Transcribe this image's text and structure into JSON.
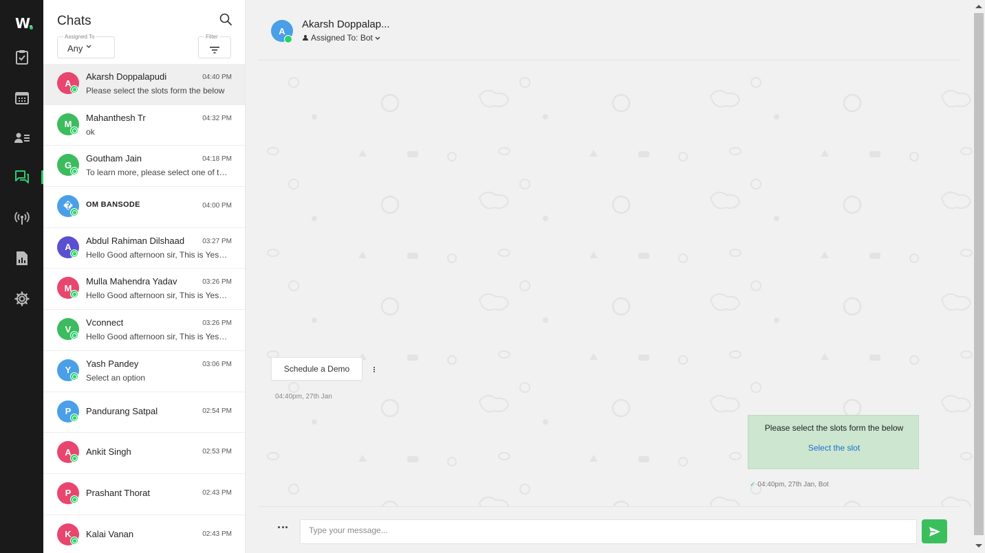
{
  "brand": {
    "logo": "W.",
    "accent": "#2ecc71"
  },
  "rail": {
    "items": [
      {
        "icon": "clipboard-check-icon"
      },
      {
        "icon": "calendar-icon"
      },
      {
        "icon": "contacts-icon"
      },
      {
        "icon": "chats-icon",
        "active": true
      },
      {
        "icon": "broadcast-icon"
      },
      {
        "icon": "report-icon"
      },
      {
        "icon": "settings-icon"
      }
    ]
  },
  "list": {
    "title": "Chats",
    "assigned_label": "Assigned To",
    "assigned_value": "Any",
    "filter_label": "Filter",
    "chats": [
      {
        "initial": "A",
        "color": "#e8466e",
        "name": "Akarsh Doppalapudi",
        "time": "04:40 PM",
        "preview": "Please select the slots form the below",
        "active": true
      },
      {
        "initial": "M",
        "color": "#3dbb5f",
        "name": "Mahanthesh Tr",
        "time": "04:32 PM",
        "preview": "ok"
      },
      {
        "initial": "G",
        "color": "#3dbb5f",
        "name": "Goutham Jain",
        "time": "04:18 PM",
        "preview": "To learn more, please select one of th..."
      },
      {
        "initial": "�",
        "color": "#4a9fe8",
        "name": "OM BANSODE",
        "time": "04:00 PM",
        "preview": "",
        "bold": true
      },
      {
        "initial": "A",
        "color": "#5b4fd1",
        "name": "Abdul Rahiman Dilshaad",
        "time": "03:27 PM",
        "preview": "Hello Good afternoon sir, This is Yesw..."
      },
      {
        "initial": "M",
        "color": "#e8466e",
        "name": "Mulla Mahendra Yadav",
        "time": "03:26 PM",
        "preview": "Hello Good afternoon sir, This is Yesw..."
      },
      {
        "initial": "V",
        "color": "#3dbb5f",
        "name": "Vconnect",
        "time": "03:26 PM",
        "preview": "Hello Good afternoon sir, This is Yesw..."
      },
      {
        "initial": "Y",
        "color": "#4a9fe8",
        "name": "Yash Pandey",
        "time": "03:06 PM",
        "preview": "Select an option"
      },
      {
        "initial": "P",
        "color": "#4a9fe8",
        "name": "Pandurang Satpal",
        "time": "02:54 PM",
        "preview": ""
      },
      {
        "initial": "A",
        "color": "#e8466e",
        "name": "Ankit Singh",
        "time": "02:53 PM",
        "preview": ""
      },
      {
        "initial": "P",
        "color": "#e8466e",
        "name": "Prashant Thorat",
        "time": "02:43 PM",
        "preview": ""
      },
      {
        "initial": "K",
        "color": "#e8466e",
        "name": "Kalai Vanan",
        "time": "02:43 PM",
        "preview": ""
      }
    ]
  },
  "conversation": {
    "avatar_initial": "A",
    "name": "Akarsh Doppalap...",
    "assigned": "Assigned To: Bot",
    "incoming_button": "Schedule a Demo",
    "incoming_time": "04:40pm, 27th Jan",
    "outgoing_text": "Please select the slots form the below",
    "outgoing_link": "Select the slot",
    "outgoing_time": "04:40pm, 27th Jan, Bot",
    "compose_placeholder": "Type your message..."
  }
}
